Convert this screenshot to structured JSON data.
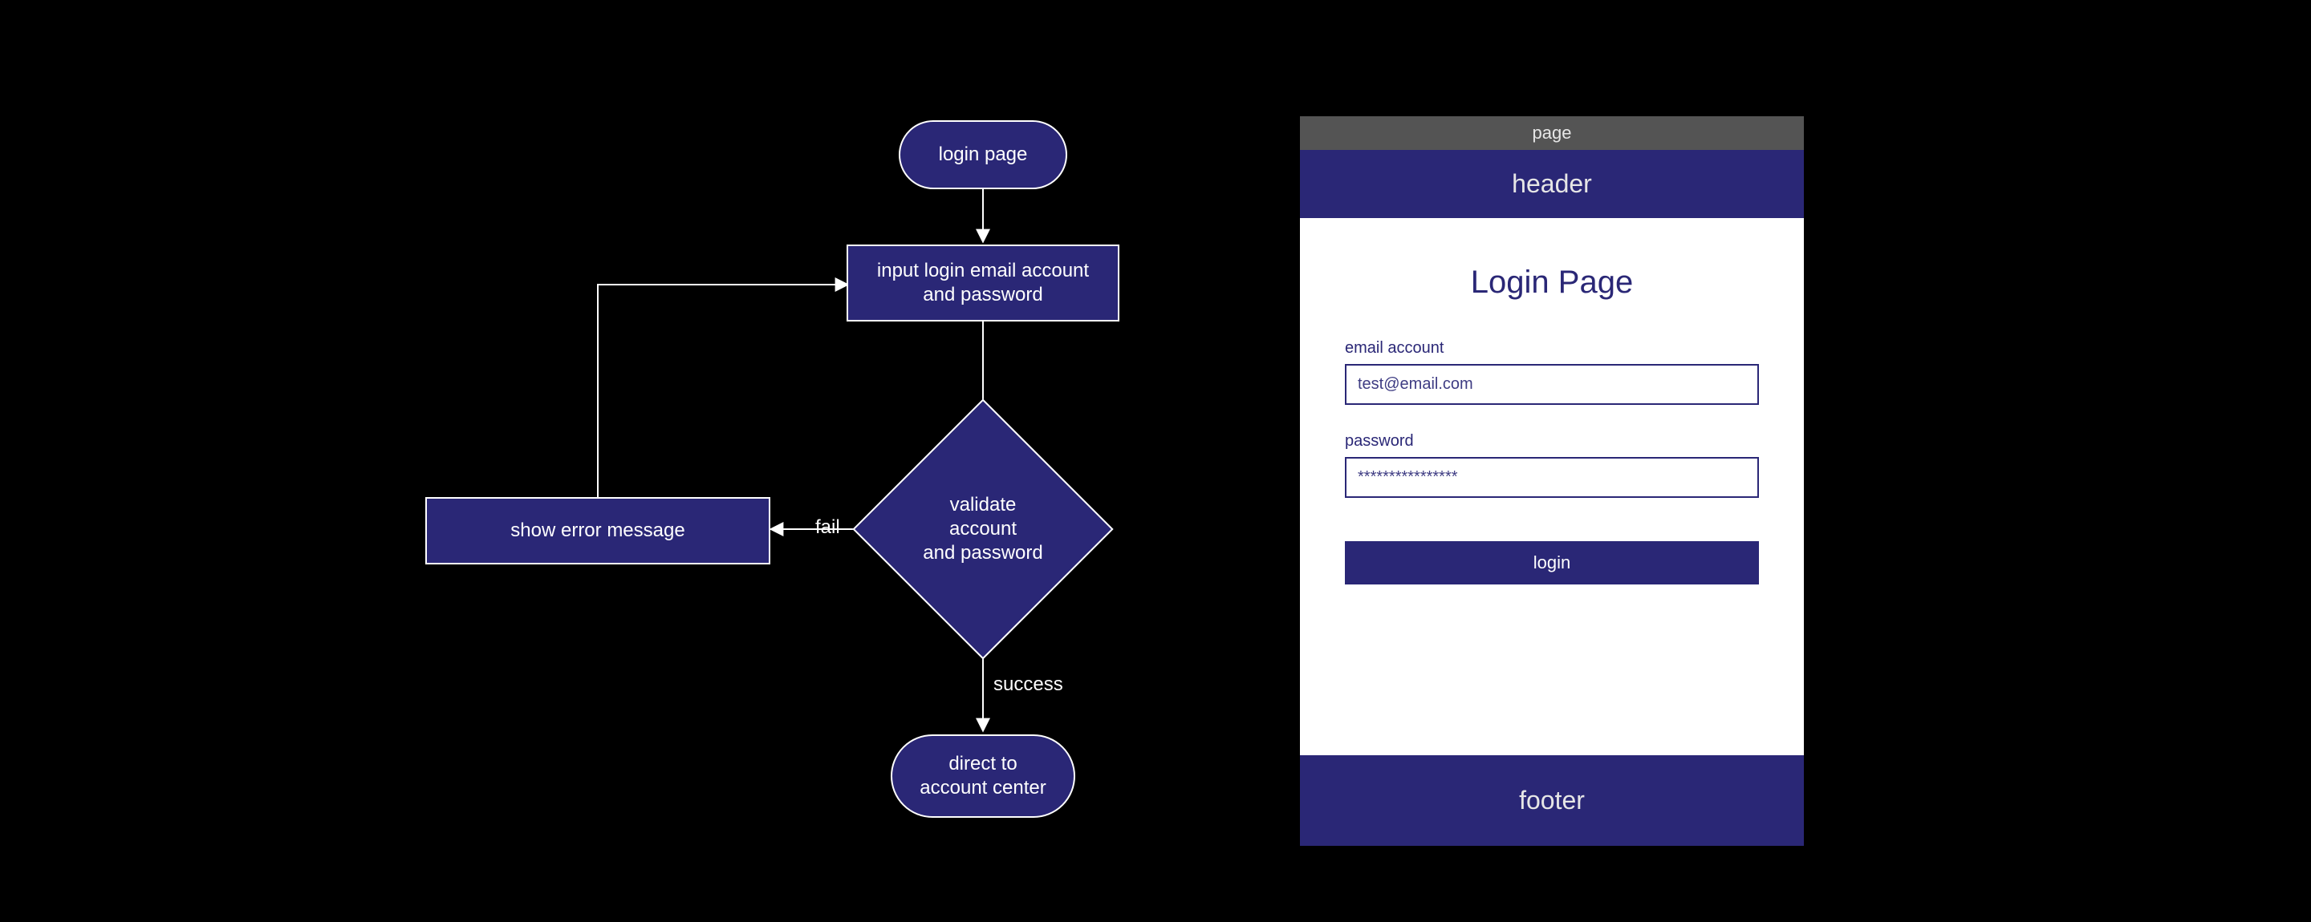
{
  "flowchart": {
    "start": "login page",
    "input": "input login email account\nand password",
    "decision": "validate account\nand password",
    "error": "show error message",
    "end": "direct to\naccount center",
    "edge_fail": "fail",
    "edge_success": "success"
  },
  "mock": {
    "page_tab": "page",
    "header": "header",
    "title": "Login Page",
    "email_label": "email account",
    "email_placeholder": "test@email.com",
    "password_label": "password",
    "password_placeholder": "****************",
    "login_button": "login",
    "footer": "footer"
  },
  "colors": {
    "accent": "#2a2776",
    "page_tab_bg": "#545454"
  }
}
